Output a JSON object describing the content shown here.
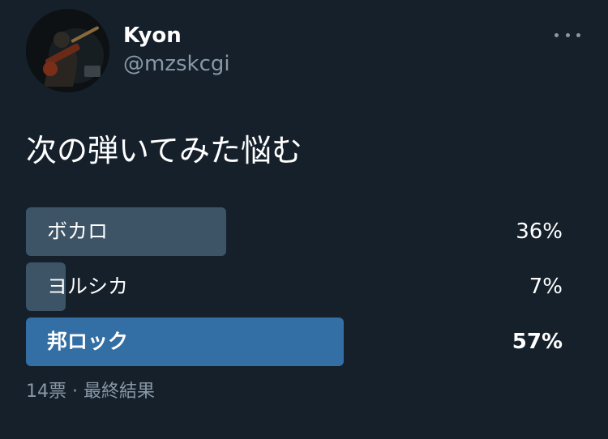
{
  "user": {
    "display_name": "Kyon",
    "handle": "@mzskcgi"
  },
  "tweet": {
    "text": "次の弾いてみた悩む"
  },
  "poll": {
    "options": [
      {
        "label": "ボカロ",
        "percent_text": "36%",
        "percent": 36,
        "winner": false
      },
      {
        "label": "ヨルシカ",
        "percent_text": "7%",
        "percent": 7,
        "winner": false
      },
      {
        "label": "邦ロック",
        "percent_text": "57%",
        "percent": 57,
        "winner": true
      }
    ],
    "votes": "14票",
    "separator": "·",
    "status": "最終結果"
  },
  "colors": {
    "background": "#15202b",
    "bar": "#3d5466",
    "winner_bar": "#336fa4",
    "secondary_text": "#8899a6"
  },
  "icons": {
    "more": "more-horizontal-icon"
  }
}
